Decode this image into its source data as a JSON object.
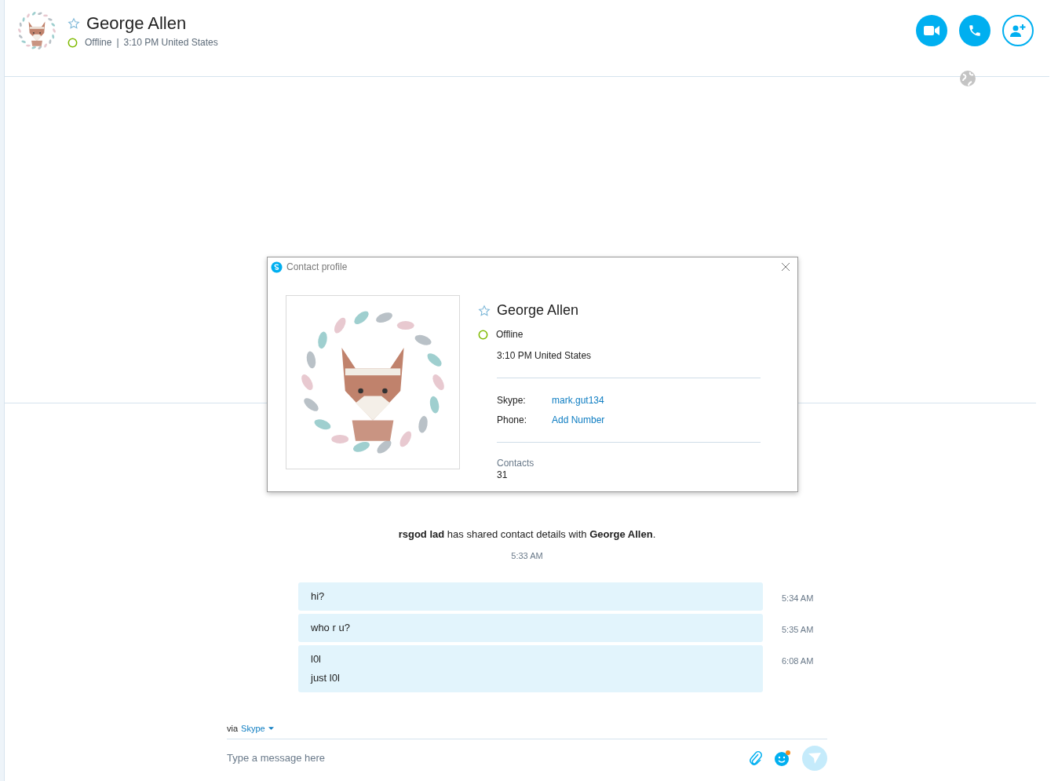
{
  "header": {
    "name": "George Allen",
    "favorite": false,
    "status": "Offline",
    "separator": "|",
    "local_time": "3:10 PM United States"
  },
  "dialog": {
    "title": "Contact profile",
    "name": "George Allen",
    "favorite": false,
    "status": "Offline",
    "local_time": "3:10 PM United States",
    "fields": [
      {
        "label": "Skype:",
        "value": "mark.gut134"
      },
      {
        "label": "Phone:",
        "value": "Add Number"
      }
    ],
    "contacts_label": "Contacts",
    "contacts_count": "31"
  },
  "system_message": {
    "text": "**rsgod lad** has shared contact details with **George Allen**.",
    "time": "5:33 AM"
  },
  "messages": [
    {
      "lines": [
        "hi?"
      ],
      "time": "5:34 AM"
    },
    {
      "lines": [
        "who r u?"
      ],
      "time": "5:35 AM"
    },
    {
      "lines": [
        "l0l",
        "just l0l"
      ],
      "time": "6:08 AM"
    }
  ],
  "composer": {
    "via": "via",
    "channel": "Skype",
    "placeholder": "Type a message here"
  }
}
